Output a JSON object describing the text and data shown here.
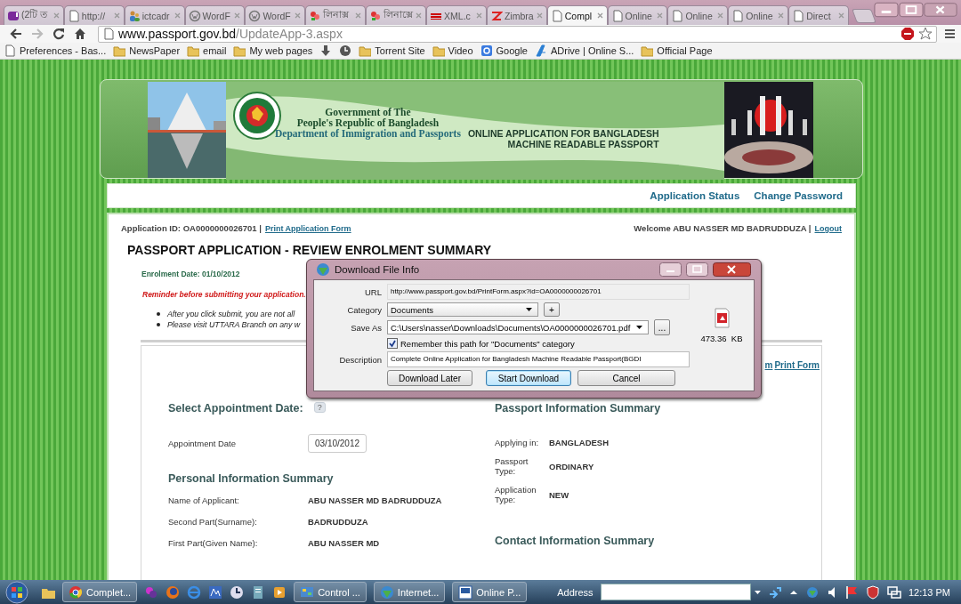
{
  "browser": {
    "tabs": [
      {
        "label": "(2টি ত",
        "kind": "yahoo",
        "selected": false
      },
      {
        "label": "http://",
        "kind": "page",
        "selected": false
      },
      {
        "label": "ictcadr",
        "kind": "people",
        "selected": false
      },
      {
        "label": "WordF",
        "kind": "wordpress",
        "selected": false
      },
      {
        "label": "WordF",
        "kind": "wordpress",
        "selected": false
      },
      {
        "label": "লিনাক্স",
        "kind": "flower",
        "selected": false
      },
      {
        "label": "লিনাক্সে",
        "kind": "flower",
        "selected": false
      },
      {
        "label": "XML.c",
        "kind": "xml",
        "selected": false
      },
      {
        "label": "Zimbra",
        "kind": "zimbra",
        "selected": false
      },
      {
        "label": "Compl",
        "kind": "page",
        "selected": true
      },
      {
        "label": "Online",
        "kind": "page",
        "selected": false
      },
      {
        "label": "Online",
        "kind": "page",
        "selected": false
      },
      {
        "label": "Online",
        "kind": "page",
        "selected": false
      },
      {
        "label": "Direct",
        "kind": "page",
        "selected": false
      }
    ],
    "address": {
      "host": "www.passport.gov.bd",
      "path": "/UpdateApp-3.aspx"
    },
    "bookmarks": [
      {
        "label": "Preferences - Bas...",
        "kind": "page"
      },
      {
        "label": "NewsPaper",
        "kind": "folder"
      },
      {
        "label": "email",
        "kind": "folder"
      },
      {
        "label": "My web pages",
        "kind": "folder"
      },
      {
        "kind": "download"
      },
      {
        "kind": "clock"
      },
      {
        "label": "Torrent Site",
        "kind": "folder"
      },
      {
        "label": "Video",
        "kind": "folder"
      },
      {
        "label": "Google",
        "kind": "google"
      },
      {
        "label": "ADrive | Online S...",
        "kind": "adrive"
      },
      {
        "label": "Official Page",
        "kind": "folder"
      }
    ]
  },
  "page": {
    "header": {
      "government": [
        "Government of The",
        "People's Republic of Bangladesh"
      ],
      "department": "Department of Immigration and Passports",
      "tagline": [
        "ONLINE APPLICATION FOR BANGLADESH",
        "MACHINE READABLE PASSPORT"
      ]
    },
    "nav_links": [
      "Application Status",
      "Change Password"
    ],
    "application_id": "Application ID: OA0000000026701 |",
    "print_application_link": "Print Application Form",
    "welcome": "Welcome ABU NASSER MD BADRUDDUZA |",
    "logout_link": "Logout",
    "heading": "PASSPORT APPLICATION - REVIEW ENROLMENT SUMMARY",
    "enrolment_date": "Enrolment Date: 01/10/2012",
    "reminder": "Reminder before submitting your application.",
    "bullets": [
      "After you click submit, you are not all",
      "Please visit UTTARA Branch  on any w"
    ],
    "link_fragment": "m",
    "print_form_link": "Print Form",
    "appointment": {
      "title": "Select Appointment Date:",
      "help": "?",
      "label": "Appointment Date",
      "value": "03/10/2012"
    },
    "personal": {
      "title": "Personal Information Summary",
      "rows": [
        {
          "label": "Name of Applicant:",
          "value": "ABU NASSER MD BADRUDDUZA"
        },
        {
          "label": "Second Part(Surname):",
          "value": "BADRUDDUZA"
        },
        {
          "label": "First Part(Given Name):",
          "value": "ABU NASSER MD"
        }
      ]
    },
    "passport": {
      "title": "Passport Information Summary",
      "rows": [
        {
          "label": "Applying in:",
          "value": "BANGLADESH"
        },
        {
          "label": "Passport Type:",
          "value": "ORDINARY"
        },
        {
          "label": "Application Type:",
          "value": "NEW"
        }
      ]
    },
    "contact": {
      "title": "Contact Information Summary"
    }
  },
  "dialog": {
    "title": "Download File Info",
    "url_label": "URL",
    "url": "http://www.passport.gov.bd/PrintForm.aspx?id=OA0000000026701",
    "category_label": "Category",
    "category": "Documents",
    "add": "+",
    "save_label": "Save As",
    "save_path": "C:\\Users\\nasser\\Downloads\\Documents\\OA0000000026701.pdf",
    "browse": "...",
    "remember": {
      "label": "Remember this path for \"Documents\" category",
      "checked": true
    },
    "description_label": "Description",
    "description": "Complete Online Application for Bangladesh Machine Readable Passport(BGDI",
    "size": "473.36  KB",
    "buttons": [
      {
        "label": "Download Later",
        "default": false
      },
      {
        "label": "Start Download",
        "default": true
      },
      {
        "label": "Cancel",
        "default": false
      }
    ]
  },
  "taskbar": {
    "items": [
      {
        "kind": "folder"
      },
      {
        "kind": "chrome",
        "label": "Complet..."
      },
      {
        "kind": "paint"
      },
      {
        "kind": "firefox"
      },
      {
        "kind": "ie"
      },
      {
        "kind": "app"
      },
      {
        "kind": "clock"
      },
      {
        "kind": "doc"
      },
      {
        "kind": "media"
      },
      {
        "kind": "control",
        "label": "Control ..."
      },
      {
        "kind": "globe",
        "label": "Internet..."
      },
      {
        "kind": "word",
        "label": "Online P..."
      }
    ],
    "address_label": "Address",
    "clock": "12:13 PM"
  }
}
